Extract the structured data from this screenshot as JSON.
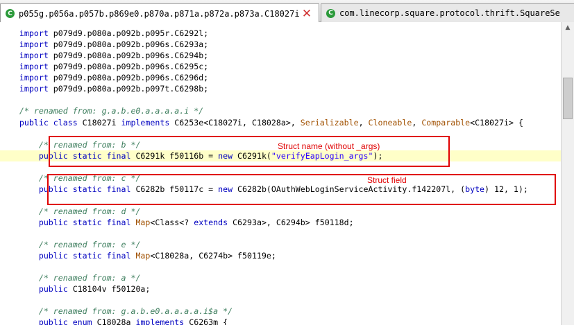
{
  "tabs": [
    {
      "title": "p055g.p056a.p057b.p869e0.p870a.p871a.p872a.p873a.C18027i",
      "icon": "class-icon",
      "active": true
    },
    {
      "title": "com.linecorp.square.protocol.thrift.SquareSe",
      "icon": "class-icon",
      "active": false
    }
  ],
  "code": {
    "imports": [
      "p079d9.p080a.p092b.p095r.C6292l;",
      "p079d9.p080a.p092b.p096s.C6293a;",
      "p079d9.p080a.p092b.p096s.C6294b;",
      "p079d9.p080a.p092b.p096s.C6295c;",
      "p079d9.p080a.p092b.p096s.C6296d;",
      "p079d9.p080a.p092b.p097t.C6298b;"
    ],
    "import_kw": "import",
    "class_comment": "/* renamed from: g.a.b.e0.a.a.a.a.i */",
    "class_decl": {
      "mods": "public class",
      "name": " C18027i ",
      "implements_kw": "implements",
      "base": " C6253e<C18027i, C18028a>, ",
      "serializable": "Serializable",
      "sep1": ", ",
      "cloneable": "Cloneable",
      "sep2": ", ",
      "comparable": "Comparable",
      "tail": "<C18027i> {"
    },
    "field_b": {
      "comment": "/* renamed from: b */",
      "mods": "public static final",
      "decl": " C6291k f50116b = ",
      "new_kw": "new",
      "ctor": " C6291k(",
      "arg": "\"verifyEapLogin_args\"",
      "end": ");"
    },
    "field_c": {
      "comment": "/* renamed from: c */",
      "mods": "public static final",
      "decl": " C6282b f50117c = ",
      "new_kw": "new",
      "ctor": " C6282b(OAuthWebLoginServiceActivity.f142207l, (",
      "byte_kw": "byte",
      "end": ") 12, 1);"
    },
    "field_d": {
      "comment": "/* renamed from: d */",
      "mods": "public static final",
      "map": " Map",
      "p1": "<Class<? ",
      "extends_kw": "extends",
      "p2": " C6293a>, C6294b> f50118d;"
    },
    "field_e": {
      "comment": "/* renamed from: e */",
      "mods": "public static final",
      "map": " Map",
      "p1": "<C18028a, C6274b> f50119e;"
    },
    "field_a": {
      "comment": "/* renamed from: a */",
      "mods": "public",
      "decl": " C18104v f50120a;"
    },
    "enum_a": {
      "comment": "/* renamed from: g.a.b.e0.a.a.a.a.i$a */",
      "mods": "public enum",
      "decl": " C18028a ",
      "implements_kw": "implements",
      "tail": " C6263m {"
    }
  },
  "annotations": {
    "struct_name": "Struct name (without _args)",
    "struct_field": "Struct field"
  },
  "colors": {
    "keyword": "#0000c0",
    "comment": "#3f7f5f",
    "type_link": "#a05000",
    "string": "#2a00ff",
    "annotation": "#e00000",
    "highlight_line": "#ffffc8"
  }
}
